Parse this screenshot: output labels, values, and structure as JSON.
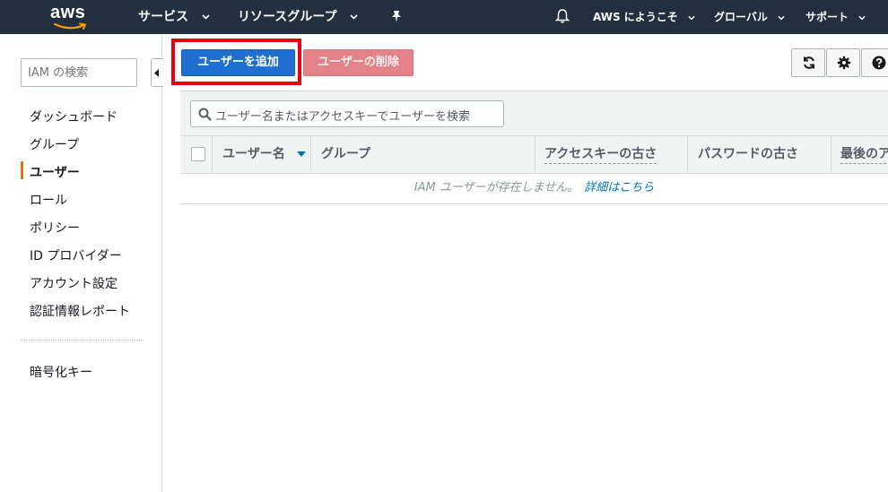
{
  "header": {
    "logo": "aws",
    "services": "サービス",
    "resource_groups": "リソースグループ",
    "account": "AWS にようこそ",
    "region": "グローバル",
    "support": "サポート"
  },
  "sidebar": {
    "search_placeholder": "IAM の検索",
    "items": [
      "ダッシュボード",
      "グループ",
      "ユーザー",
      "ロール",
      "ポリシー",
      "ID プロバイダー",
      "アカウント設定",
      "認証情報レポート"
    ],
    "active_index": 2,
    "secondary_items": [
      "暗号化キー"
    ]
  },
  "actions": {
    "add_user": "ユーザーを追加",
    "delete_user": "ユーザーの削除"
  },
  "table": {
    "filter_placeholder": "ユーザー名またはアクセスキーでユーザーを検索",
    "columns": [
      "ユーザー名",
      "グループ",
      "アクセスキーの古さ",
      "パスワードの古さ",
      "最後のア"
    ],
    "empty_message": "IAM ユーザーが存在しません。",
    "empty_link": "詳細はこちら"
  },
  "colors": {
    "nav_bg": "#232f3e",
    "primary_button": "#1f6fd0",
    "danger_button": "#e38289",
    "highlight": "#e8000c",
    "active_indicator": "#ec7211",
    "link": "#0073bb"
  },
  "icons": [
    "caret-down-icon",
    "pin-icon",
    "bell-icon",
    "refresh-icon",
    "gear-icon",
    "help-icon",
    "search-icon",
    "sort-down-icon",
    "collapse-left-icon"
  ]
}
